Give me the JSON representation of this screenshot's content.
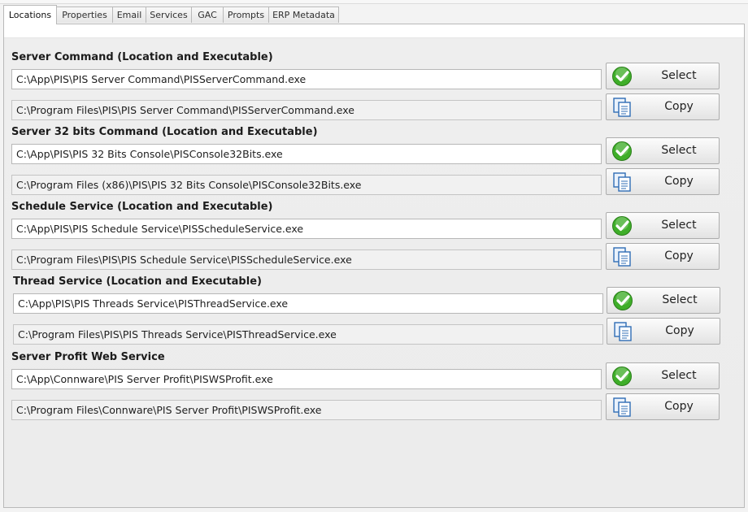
{
  "tabs": [
    "Locations",
    "Properties",
    "Email",
    "Services",
    "GAC",
    "Prompts",
    "ERP Metadata"
  ],
  "active_tab": "Locations",
  "buttons": {
    "select_label": "Select",
    "copy_label": "Copy"
  },
  "icons": {
    "select": "green-check-icon",
    "copy": "copy-documents-icon"
  },
  "colors": {
    "check_green": "#3fae29",
    "copy_blue": "#2f6db5"
  },
  "groups": [
    {
      "title": "Server Command (Location and Executable)",
      "path": "C:\\App\\PIS\\PIS Server Command\\PISServerCommand.exe",
      "install_path": "C:\\Program Files\\PIS\\PIS Server Command\\PISServerCommand.exe"
    },
    {
      "title": "Server 32 bits Command (Location and Executable)",
      "path": "C:\\App\\PIS\\PIS 32 Bits Console\\PISConsole32Bits.exe",
      "install_path": "C:\\Program Files (x86)\\PIS\\PIS 32 Bits Console\\PISConsole32Bits.exe"
    },
    {
      "title": "Schedule Service (Location and Executable)",
      "path": "C:\\App\\PIS\\PIS Schedule Service\\PISScheduleService.exe",
      "install_path": "C:\\Program Files\\PIS\\PIS Schedule Service\\PISScheduleService.exe"
    },
    {
      "title": "Thread Service (Location and Executable)",
      "path": "C:\\App\\PIS\\PIS Threads Service\\PISThreadService.exe",
      "install_path": "C:\\Program Files\\PIS\\PIS Threads Service\\PISThreadService.exe"
    },
    {
      "title": "Server Profit Web Service",
      "path": "C:\\App\\Connware\\PIS Server Profit\\PISWSProfit.exe",
      "install_path": "C:\\Program Files\\Connware\\PIS Server Profit\\PISWSProfit.exe"
    }
  ]
}
